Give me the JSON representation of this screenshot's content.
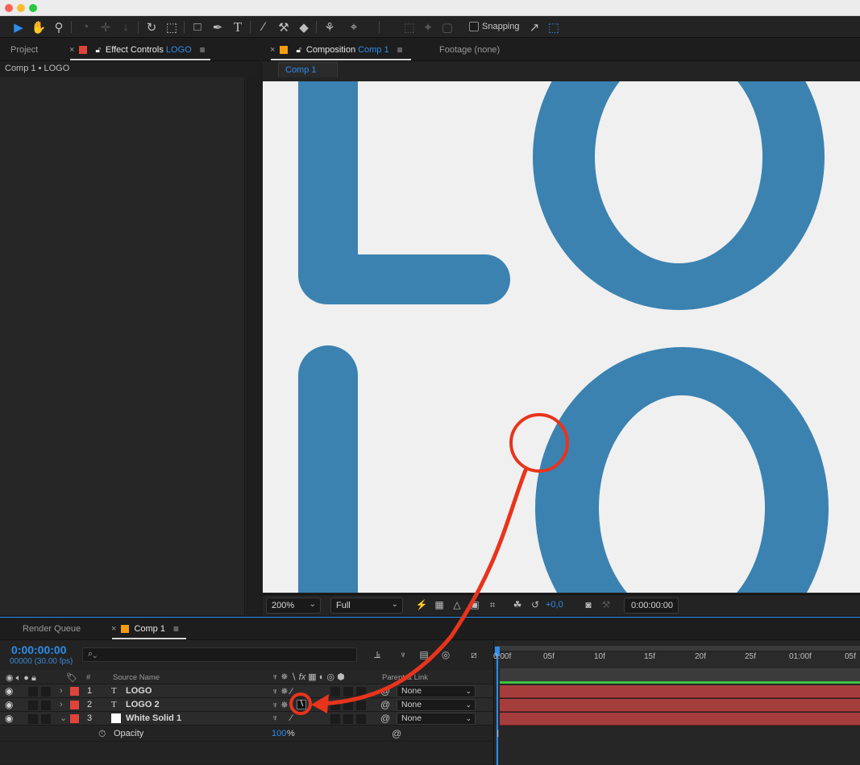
{
  "toolbar": {
    "snapping_label": "Snapping",
    "tools": [
      "selection-tool",
      "hand-tool",
      "zoom-tool",
      "orbit-tool",
      "pan-behind-tool",
      "dolly-tool",
      "rotation-tool",
      "anchor-tool",
      "rectangle-tool",
      "pen-tool",
      "type-tool",
      "brush-tool",
      "clone-stamp-tool",
      "eraser-tool",
      "roto-brush-tool",
      "puppet-pin-tool"
    ]
  },
  "left_panel": {
    "tab_project": "Project",
    "tab_effect_controls_prefix": "Effect Controls",
    "tab_effect_controls_layer": "LOGO",
    "breadcrumb": "Comp 1 • LOGO"
  },
  "comp_panel": {
    "tab_composition_prefix": "Composition",
    "tab_composition_name": "Comp 1",
    "tab_footage": "Footage (none)",
    "subtab": "Comp 1",
    "zoom": "200%",
    "resolution": "Full",
    "exposure": "+0,0",
    "timecode": "0:00:00:00",
    "logo_color": "#3b82b1"
  },
  "timeline": {
    "tab_render_queue": "Render Queue",
    "tab_comp": "Comp 1",
    "current_time": "0:00:00:00",
    "frame_info": "00000 (30.00 fps)",
    "search_placeholder": "",
    "col_number": "#",
    "col_source_name": "Source Name",
    "col_parent": "Parent & Link",
    "ruler": [
      "0:00f",
      "05f",
      "10f",
      "15f",
      "20f",
      "25f",
      "01:00f",
      "05f"
    ],
    "layers": [
      {
        "num": "1",
        "type_glyph": "T",
        "name": "LOGO",
        "parent": "None",
        "label_color": "#e0433a"
      },
      {
        "num": "2",
        "type_glyph": "T",
        "name": "LOGO 2",
        "parent": "None",
        "label_color": "#e0433a"
      },
      {
        "num": "3",
        "type_glyph": "",
        "name": "White Solid 1",
        "parent": "None",
        "label_color": "#e0433a"
      }
    ],
    "property_name": "Opacity",
    "property_value": "100",
    "property_unit": "%",
    "track_color": "#a63d3d"
  },
  "annotation": {
    "color": "#e8341c"
  }
}
